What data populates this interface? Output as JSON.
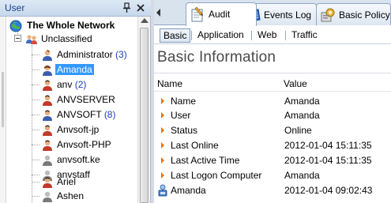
{
  "user_panel": {
    "title": "User",
    "root_label": "The Whole Network",
    "group_label": "Unclassified",
    "users": [
      {
        "name": "Administrator",
        "count": "(3)",
        "selected": false
      },
      {
        "name": "Amanda",
        "count": "",
        "selected": true
      },
      {
        "name": "anv",
        "count": "(2)",
        "selected": false
      },
      {
        "name": "ANVSERVER",
        "count": "",
        "selected": false
      },
      {
        "name": "ANVSOFT",
        "count": "(8)",
        "selected": false
      },
      {
        "name": "Anvsoft-jp",
        "count": "",
        "selected": false
      },
      {
        "name": "Anvsoft-PHP",
        "count": "",
        "selected": false
      },
      {
        "name": "anvsoft.ke",
        "count": "",
        "selected": false
      },
      {
        "name": "anvstaff",
        "count": "",
        "selected": false
      },
      {
        "name": "Ariel",
        "count": "",
        "selected": false
      },
      {
        "name": "Ashen",
        "count": "",
        "selected": false
      }
    ]
  },
  "tabs": [
    {
      "label": "Audit",
      "icon": "audit-icon",
      "active": true
    },
    {
      "label": "Events Log",
      "icon": "events-log-icon",
      "active": false
    },
    {
      "label": "Basic Policy",
      "icon": "basic-policy-icon",
      "active": false
    }
  ],
  "subtabs": [
    {
      "label": "Basic",
      "active": true
    },
    {
      "label": "Application",
      "active": false
    },
    {
      "label": "Web",
      "active": false
    },
    {
      "label": "Traffic",
      "active": false
    }
  ],
  "info": {
    "section_title": "Basic Information",
    "col_name": "Name",
    "col_value": "Value",
    "rows": [
      {
        "name": "Name",
        "value": "Amanda"
      },
      {
        "name": "User",
        "value": "Amanda"
      },
      {
        "name": "Status",
        "value": "Online"
      },
      {
        "name": "Last Online",
        "value": "2012-01-04 15:11:35"
      },
      {
        "name": "Last Active Time",
        "value": "2012-01-04 15:11:35"
      },
      {
        "name": "Last Logon Computer",
        "value": "Amanda"
      }
    ],
    "computer_row": {
      "name": "Amanda",
      "value": "2012-01-04 09:02:43"
    }
  },
  "colors": {
    "accent_selection": "#3399ff",
    "count_text": "#1a3cc2",
    "arrow_orange": "#e07818",
    "header_text": "#15428b"
  }
}
